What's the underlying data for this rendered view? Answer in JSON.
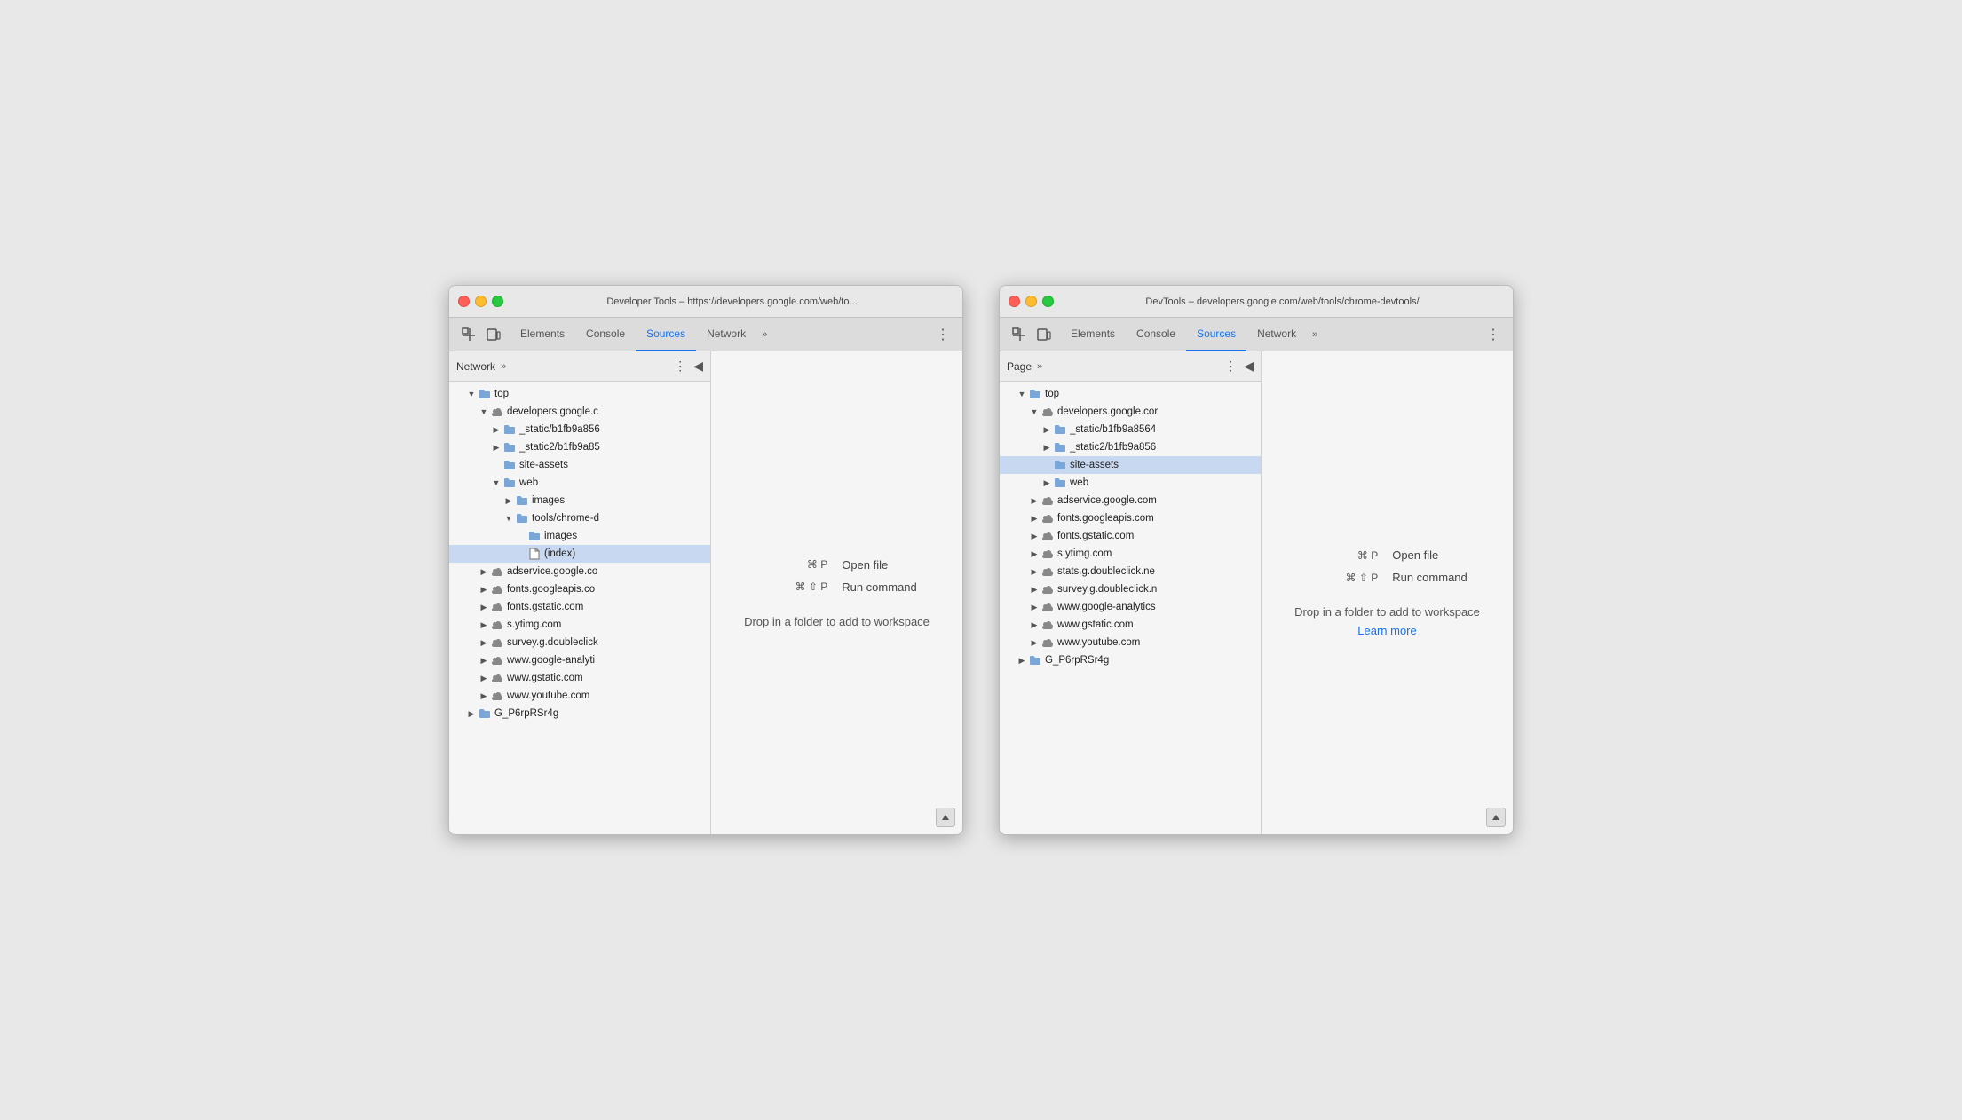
{
  "windows": [
    {
      "id": "window-left",
      "titleBar": {
        "title": "Developer Tools – https://developers.google.com/web/to..."
      },
      "tabs": {
        "items": [
          "Elements",
          "Console",
          "Sources",
          "Network"
        ],
        "active": "Sources",
        "more": "»",
        "menuIcon": "⋮"
      },
      "sidebar": {
        "header": {
          "label": "Network",
          "more": "»",
          "dotsIcon": "⋮",
          "collapseIcon": "◀"
        },
        "tree": [
          {
            "indent": 1,
            "arrow": "▼",
            "iconType": "folder",
            "label": "top",
            "selected": false
          },
          {
            "indent": 2,
            "arrow": "▼",
            "iconType": "cloud",
            "label": "developers.google.c",
            "selected": false
          },
          {
            "indent": 3,
            "arrow": "▶",
            "iconType": "folder",
            "label": "_static/b1fb9a856",
            "selected": false
          },
          {
            "indent": 3,
            "arrow": "▶",
            "iconType": "folder",
            "label": "_static2/b1fb9a85",
            "selected": false
          },
          {
            "indent": 3,
            "arrow": " ",
            "iconType": "folder",
            "label": "site-assets",
            "selected": false
          },
          {
            "indent": 3,
            "arrow": "▼",
            "iconType": "folder",
            "label": "web",
            "selected": false
          },
          {
            "indent": 4,
            "arrow": "▶",
            "iconType": "folder",
            "label": "images",
            "selected": false
          },
          {
            "indent": 4,
            "arrow": "▼",
            "iconType": "folder",
            "label": "tools/chrome-d",
            "selected": false
          },
          {
            "indent": 5,
            "arrow": " ",
            "iconType": "folder",
            "label": "images",
            "selected": false
          },
          {
            "indent": 5,
            "arrow": " ",
            "iconType": "file",
            "label": "(index)",
            "selected": true
          },
          {
            "indent": 2,
            "arrow": "▶",
            "iconType": "cloud",
            "label": "adservice.google.co",
            "selected": false
          },
          {
            "indent": 2,
            "arrow": "▶",
            "iconType": "cloud",
            "label": "fonts.googleapis.co",
            "selected": false
          },
          {
            "indent": 2,
            "arrow": "▶",
            "iconType": "cloud",
            "label": "fonts.gstatic.com",
            "selected": false
          },
          {
            "indent": 2,
            "arrow": "▶",
            "iconType": "cloud",
            "label": "s.ytimg.com",
            "selected": false
          },
          {
            "indent": 2,
            "arrow": "▶",
            "iconType": "cloud",
            "label": "survey.g.doubleclick",
            "selected": false
          },
          {
            "indent": 2,
            "arrow": "▶",
            "iconType": "cloud",
            "label": "www.google-analyti",
            "selected": false
          },
          {
            "indent": 2,
            "arrow": "▶",
            "iconType": "cloud",
            "label": "www.gstatic.com",
            "selected": false
          },
          {
            "indent": 2,
            "arrow": "▶",
            "iconType": "cloud",
            "label": "www.youtube.com",
            "selected": false
          },
          {
            "indent": 1,
            "arrow": "▶",
            "iconType": "folder",
            "label": "G_P6rpRSr4g",
            "selected": false
          }
        ]
      },
      "editor": {
        "shortcuts": [
          {
            "keys": "⌘ P",
            "desc": "Open file"
          },
          {
            "keys": "⌘ ⇧ P",
            "desc": "Run command"
          }
        ],
        "dropText": "Drop in a folder to add to workspace",
        "learnMore": null
      }
    },
    {
      "id": "window-right",
      "titleBar": {
        "title": "DevTools – developers.google.com/web/tools/chrome-devtools/"
      },
      "tabs": {
        "items": [
          "Elements",
          "Console",
          "Sources",
          "Network"
        ],
        "active": "Sources",
        "more": "»",
        "menuIcon": "⋮"
      },
      "sidebar": {
        "header": {
          "label": "Page",
          "more": "»",
          "dotsIcon": "⋮",
          "collapseIcon": "◀"
        },
        "tree": [
          {
            "indent": 1,
            "arrow": "▼",
            "iconType": "folder",
            "label": "top",
            "selected": false
          },
          {
            "indent": 2,
            "arrow": "▼",
            "iconType": "cloud",
            "label": "developers.google.cor",
            "selected": false
          },
          {
            "indent": 3,
            "arrow": "▶",
            "iconType": "folder",
            "label": "_static/b1fb9a8564",
            "selected": false
          },
          {
            "indent": 3,
            "arrow": "▶",
            "iconType": "folder",
            "label": "_static2/b1fb9a856",
            "selected": false
          },
          {
            "indent": 3,
            "arrow": " ",
            "iconType": "folder",
            "label": "site-assets",
            "selected": true
          },
          {
            "indent": 3,
            "arrow": "▶",
            "iconType": "folder",
            "label": "web",
            "selected": false
          },
          {
            "indent": 2,
            "arrow": "▶",
            "iconType": "cloud",
            "label": "adservice.google.com",
            "selected": false
          },
          {
            "indent": 2,
            "arrow": "▶",
            "iconType": "cloud",
            "label": "fonts.googleapis.com",
            "selected": false
          },
          {
            "indent": 2,
            "arrow": "▶",
            "iconType": "cloud",
            "label": "fonts.gstatic.com",
            "selected": false
          },
          {
            "indent": 2,
            "arrow": "▶",
            "iconType": "cloud",
            "label": "s.ytimg.com",
            "selected": false
          },
          {
            "indent": 2,
            "arrow": "▶",
            "iconType": "cloud",
            "label": "stats.g.doubleclick.ne",
            "selected": false
          },
          {
            "indent": 2,
            "arrow": "▶",
            "iconType": "cloud",
            "label": "survey.g.doubleclick.n",
            "selected": false
          },
          {
            "indent": 2,
            "arrow": "▶",
            "iconType": "cloud",
            "label": "www.google-analytics",
            "selected": false
          },
          {
            "indent": 2,
            "arrow": "▶",
            "iconType": "cloud",
            "label": "www.gstatic.com",
            "selected": false
          },
          {
            "indent": 2,
            "arrow": "▶",
            "iconType": "cloud",
            "label": "www.youtube.com",
            "selected": false
          },
          {
            "indent": 1,
            "arrow": "▶",
            "iconType": "folder",
            "label": "G_P6rpRSr4g",
            "selected": false
          }
        ]
      },
      "editor": {
        "shortcuts": [
          {
            "keys": "⌘ P",
            "desc": "Open file"
          },
          {
            "keys": "⌘ ⇧ P",
            "desc": "Run command"
          }
        ],
        "dropText": "Drop in a folder to add to workspace",
        "learnMore": "Learn more"
      }
    }
  ]
}
